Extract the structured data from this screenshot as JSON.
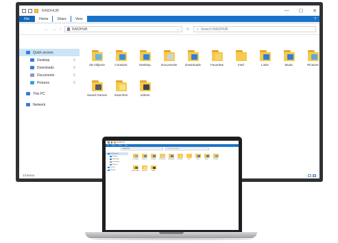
{
  "window": {
    "title": "RAIDHUB",
    "controls": [
      "—",
      "☐",
      "✕"
    ]
  },
  "ribbon": {
    "tabs": [
      "File",
      "Home",
      "Share",
      "View"
    ],
    "help": "?"
  },
  "address": {
    "path": "RAIDHUB",
    "search_placeholder": "Search RAIDHUB"
  },
  "nav": {
    "items": [
      {
        "label": "Quick access",
        "icon": "star-icon",
        "color": "#2f7fd7",
        "level": 0,
        "selected": true,
        "pinned": false
      },
      {
        "label": "Desktop",
        "icon": "desktop-icon",
        "color": "#2f7fd7",
        "level": 1,
        "selected": false,
        "pinned": true
      },
      {
        "label": "Downloads",
        "icon": "download-icon",
        "color": "#2f7fd7",
        "level": 1,
        "selected": false,
        "pinned": true
      },
      {
        "label": "Documents",
        "icon": "documents-icon",
        "color": "#8a9bb0",
        "level": 1,
        "selected": false,
        "pinned": true
      },
      {
        "label": "Pictures",
        "icon": "pictures-icon",
        "color": "#3aa0d8",
        "level": 1,
        "selected": false,
        "pinned": true
      },
      {
        "label": "This PC",
        "icon": "computer-icon",
        "color": "#3a7ad6",
        "level": 0,
        "selected": false,
        "pinned": false
      },
      {
        "label": "Network",
        "icon": "network-icon",
        "color": "#3a7ad6",
        "level": 0,
        "selected": false,
        "pinned": false
      }
    ]
  },
  "folders": [
    {
      "label": "3D Objects",
      "icon": "3d-objects-icon",
      "overlay": "#5fb8e8"
    },
    {
      "label": "Contacts",
      "icon": "contacts-icon",
      "overlay": "#3a8fd4"
    },
    {
      "label": "Desktop",
      "icon": "desktop-icon",
      "overlay": "#2f88dd"
    },
    {
      "label": "Documents",
      "icon": "documents-icon",
      "overlay": "#c9d3df"
    },
    {
      "label": "Downloads",
      "icon": "downloads-icon",
      "overlay": "#2f7fd7"
    },
    {
      "label": "Favorites",
      "icon": "favorites-icon",
      "overlay": "#f3d37a"
    },
    {
      "label": "Intel",
      "icon": "folder-icon",
      "overlay": ""
    },
    {
      "label": "Links",
      "icon": "links-icon",
      "overlay": "#2f7fd7"
    },
    {
      "label": "Music",
      "icon": "music-icon",
      "overlay": "#2f7fd7"
    },
    {
      "label": "Pictures",
      "icon": "pictures-icon",
      "overlay": "#5fa8d8"
    },
    {
      "label": "Saved Games",
      "icon": "saved-games-icon",
      "overlay": "#555b63"
    },
    {
      "label": "Searches",
      "icon": "searches-icon",
      "overlay": "#f3e08a"
    },
    {
      "label": "Videos",
      "icon": "videos-icon",
      "overlay": "#3d4450"
    }
  ],
  "status": {
    "items_count": "13 items"
  },
  "colors": {
    "ribbon_blue": "#1a73c8",
    "folder_yellow": "#f8c94a",
    "selection": "#cce4f7",
    "monitor_bezel": "#2f3134"
  }
}
